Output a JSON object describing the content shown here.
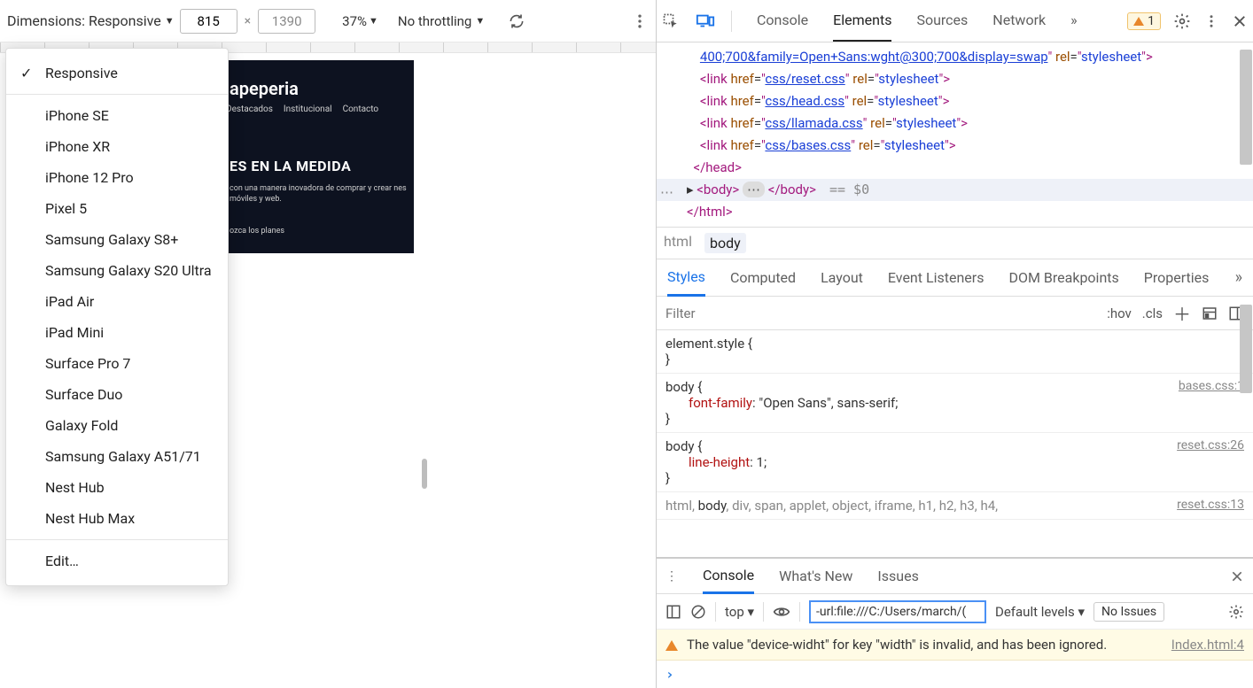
{
  "deviceToolbar": {
    "dimensionsLabel": "Dimensions: Responsive",
    "width": "815",
    "height": "1390",
    "zoom": "37%",
    "throttling": "No throttling"
  },
  "deviceDropdown": {
    "items": [
      "Responsive",
      "iPhone SE",
      "iPhone XR",
      "iPhone 12 Pro",
      "Pixel 5",
      "Samsung Galaxy S8+",
      "Samsung Galaxy S20 Ultra",
      "iPad Air",
      "iPad Mini",
      "Surface Pro 7",
      "Surface Duo",
      "Galaxy Fold",
      "Samsung Galaxy A51/71",
      "Nest Hub",
      "Nest Hub Max"
    ],
    "edit": "Edit…",
    "selectedIndex": 0
  },
  "preview": {
    "logo": "apeperia",
    "nav": [
      "Destacados",
      "Institucional",
      "Contacto"
    ],
    "headline": "ES EN LA MEDIDA",
    "sub": "con una manera inovadora de comprar y crear\nnes móviles y web.",
    "cta": "ozca los planes"
  },
  "devtoolsTabs": {
    "tabs": [
      "Console",
      "Elements",
      "Sources",
      "Network"
    ],
    "activeIndex": 1,
    "warnCount": "1"
  },
  "dom": {
    "lines": [
      {
        "indent": 2,
        "html": "<span class='link'>400;700&amp;family=Open+Sans:wght@300;700&amp;display=swap</span><span class='tag'>\"</span> <span class='attr'>rel</span>=<span class='tag'>\"</span><span class='val'>stylesheet</span><span class='tag'>\"&gt;</span>"
      },
      {
        "indent": 2,
        "html": "<span class='tag'>&lt;link</span> <span class='attr'>href</span>=<span class='tag'>\"</span><span class='link'>css/reset.css</span><span class='tag'>\"</span> <span class='attr'>rel</span>=<span class='tag'>\"</span><span class='val'>stylesheet</span><span class='tag'>\"&gt;</span>"
      },
      {
        "indent": 2,
        "html": "<span class='tag'>&lt;link</span> <span class='attr'>href</span>=<span class='tag'>\"</span><span class='link'>css/head.css</span><span class='tag'>\"</span> <span class='attr'>rel</span>=<span class='tag'>\"</span><span class='val'>stylesheet</span><span class='tag'>\"&gt;</span>"
      },
      {
        "indent": 2,
        "html": "<span class='tag'>&lt;link</span> <span class='attr'>href</span>=<span class='tag'>\"</span><span class='link'>css/llamada.css</span><span class='tag'>\"</span> <span class='attr'>rel</span>=<span class='tag'>\"</span><span class='val'>stylesheet</span><span class='tag'>\"&gt;</span>"
      },
      {
        "indent": 2,
        "html": "<span class='tag'>&lt;link</span> <span class='attr'>href</span>=<span class='tag'>\"</span><span class='link'>css/bases.css</span><span class='tag'>\"</span> <span class='attr'>rel</span>=<span class='tag'>\"</span><span class='val'>stylesheet</span><span class='tag'>\"&gt;</span>"
      },
      {
        "indent": 1,
        "html": "<span class='tag'>&lt;/head&gt;</span>"
      }
    ],
    "bodyLine": {
      "open": "<body>",
      "ell": "…",
      "close": "</body>",
      "eq": " == $0"
    },
    "closeHtml": "</html>"
  },
  "breadcrumb": {
    "items": [
      "html",
      "body"
    ],
    "activeIndex": 1
  },
  "subTabs": {
    "items": [
      "Styles",
      "Computed",
      "Layout",
      "Event Listeners",
      "DOM Breakpoints",
      "Properties"
    ],
    "activeIndex": 0
  },
  "filterRow": {
    "placeholder": "Filter",
    "hov": ":hov",
    "cls": ".cls"
  },
  "styleRules": [
    {
      "selector": "element.style {",
      "props": [],
      "close": "}"
    },
    {
      "selector": "body {",
      "source": "bases.css:1",
      "props": [
        {
          "name": "font-family",
          "value": "\"Open Sans\", sans-serif",
          "red": true
        }
      ],
      "close": "}"
    },
    {
      "selector": "body {",
      "source": "reset.css:26",
      "props": [
        {
          "name": "line-height",
          "value": "1",
          "red": true
        }
      ],
      "close": "}"
    },
    {
      "selector_html": "<span class='grey'>html,</span> body<span class='grey'>, div, span, applet, object, iframe, h1, h2, h3, h4,</span>",
      "source": "reset.css:13",
      "props": [],
      "close": ""
    }
  ],
  "drawer": {
    "tabs": [
      "Console",
      "What's New",
      "Issues"
    ],
    "activeIndex": 0,
    "context": "top",
    "filterValue": "-url:file:///C:/Users/march/(",
    "levels": "Default levels",
    "noIssues": "No Issues",
    "message": "The value \"device-widht\" for key \"width\" is invalid, and has been ignored.",
    "messageSource": "Index.html:4"
  }
}
